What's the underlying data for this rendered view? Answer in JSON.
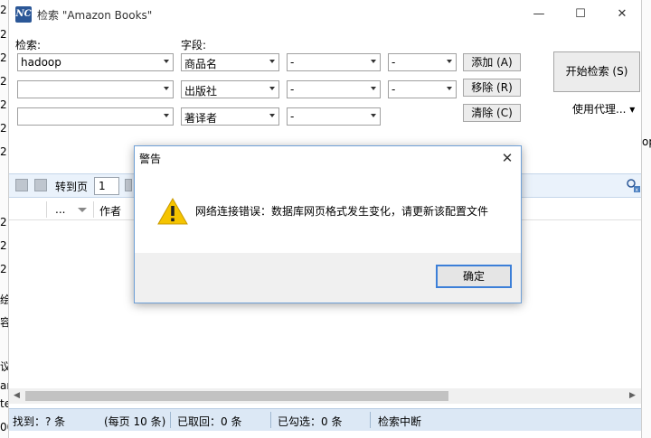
{
  "window": {
    "title": "检索 \"Amazon Books\"",
    "app_icon_text": "NC",
    "minimize": "—",
    "maximize": "☐",
    "close": "✕"
  },
  "search": {
    "label_query": "检索:",
    "label_field": "字段:",
    "rows": [
      {
        "query": "hadoop",
        "field": "商品名",
        "op1": "-",
        "op2": "-"
      },
      {
        "query": "",
        "field": "出版社",
        "op1": "-",
        "op2": "-"
      },
      {
        "query": "",
        "field": "著译者",
        "op1": "-"
      }
    ],
    "add_button": "添加 (A)",
    "remove_button": "移除 (R)",
    "clear_button": "清除 (C)",
    "start_button": "开始检索 (S)",
    "proxy_menu": "使用代理... ▾"
  },
  "toolbar": {
    "goto_label": "转到页",
    "page_value": "1"
  },
  "columns": {
    "col1": "...",
    "col2": "作者"
  },
  "status": {
    "found": "找到：? 条",
    "per_page": "(每页 10 条)",
    "fetched": "已取回：0 条",
    "checked": "已勾选：0 条",
    "state": "检索中断"
  },
  "dialog": {
    "title": "警告",
    "message": "网络连接错误：数据库网页格式发生变化，请更新该配置文件",
    "ok_button": "确定",
    "close": "✕"
  },
  "background_fragments": {
    "left": [
      "2",
      "2",
      "2",
      "2",
      "2",
      "2",
      "2",
      "2",
      "2",
      "2",
      "绘",
      "容",
      "议",
      "an",
      "te",
      "00"
    ],
    "right": [
      "op"
    ]
  },
  "colors": {
    "accent": "#3c7fd8",
    "warning": "#f5c400",
    "statusbar": "#dce8f5"
  }
}
